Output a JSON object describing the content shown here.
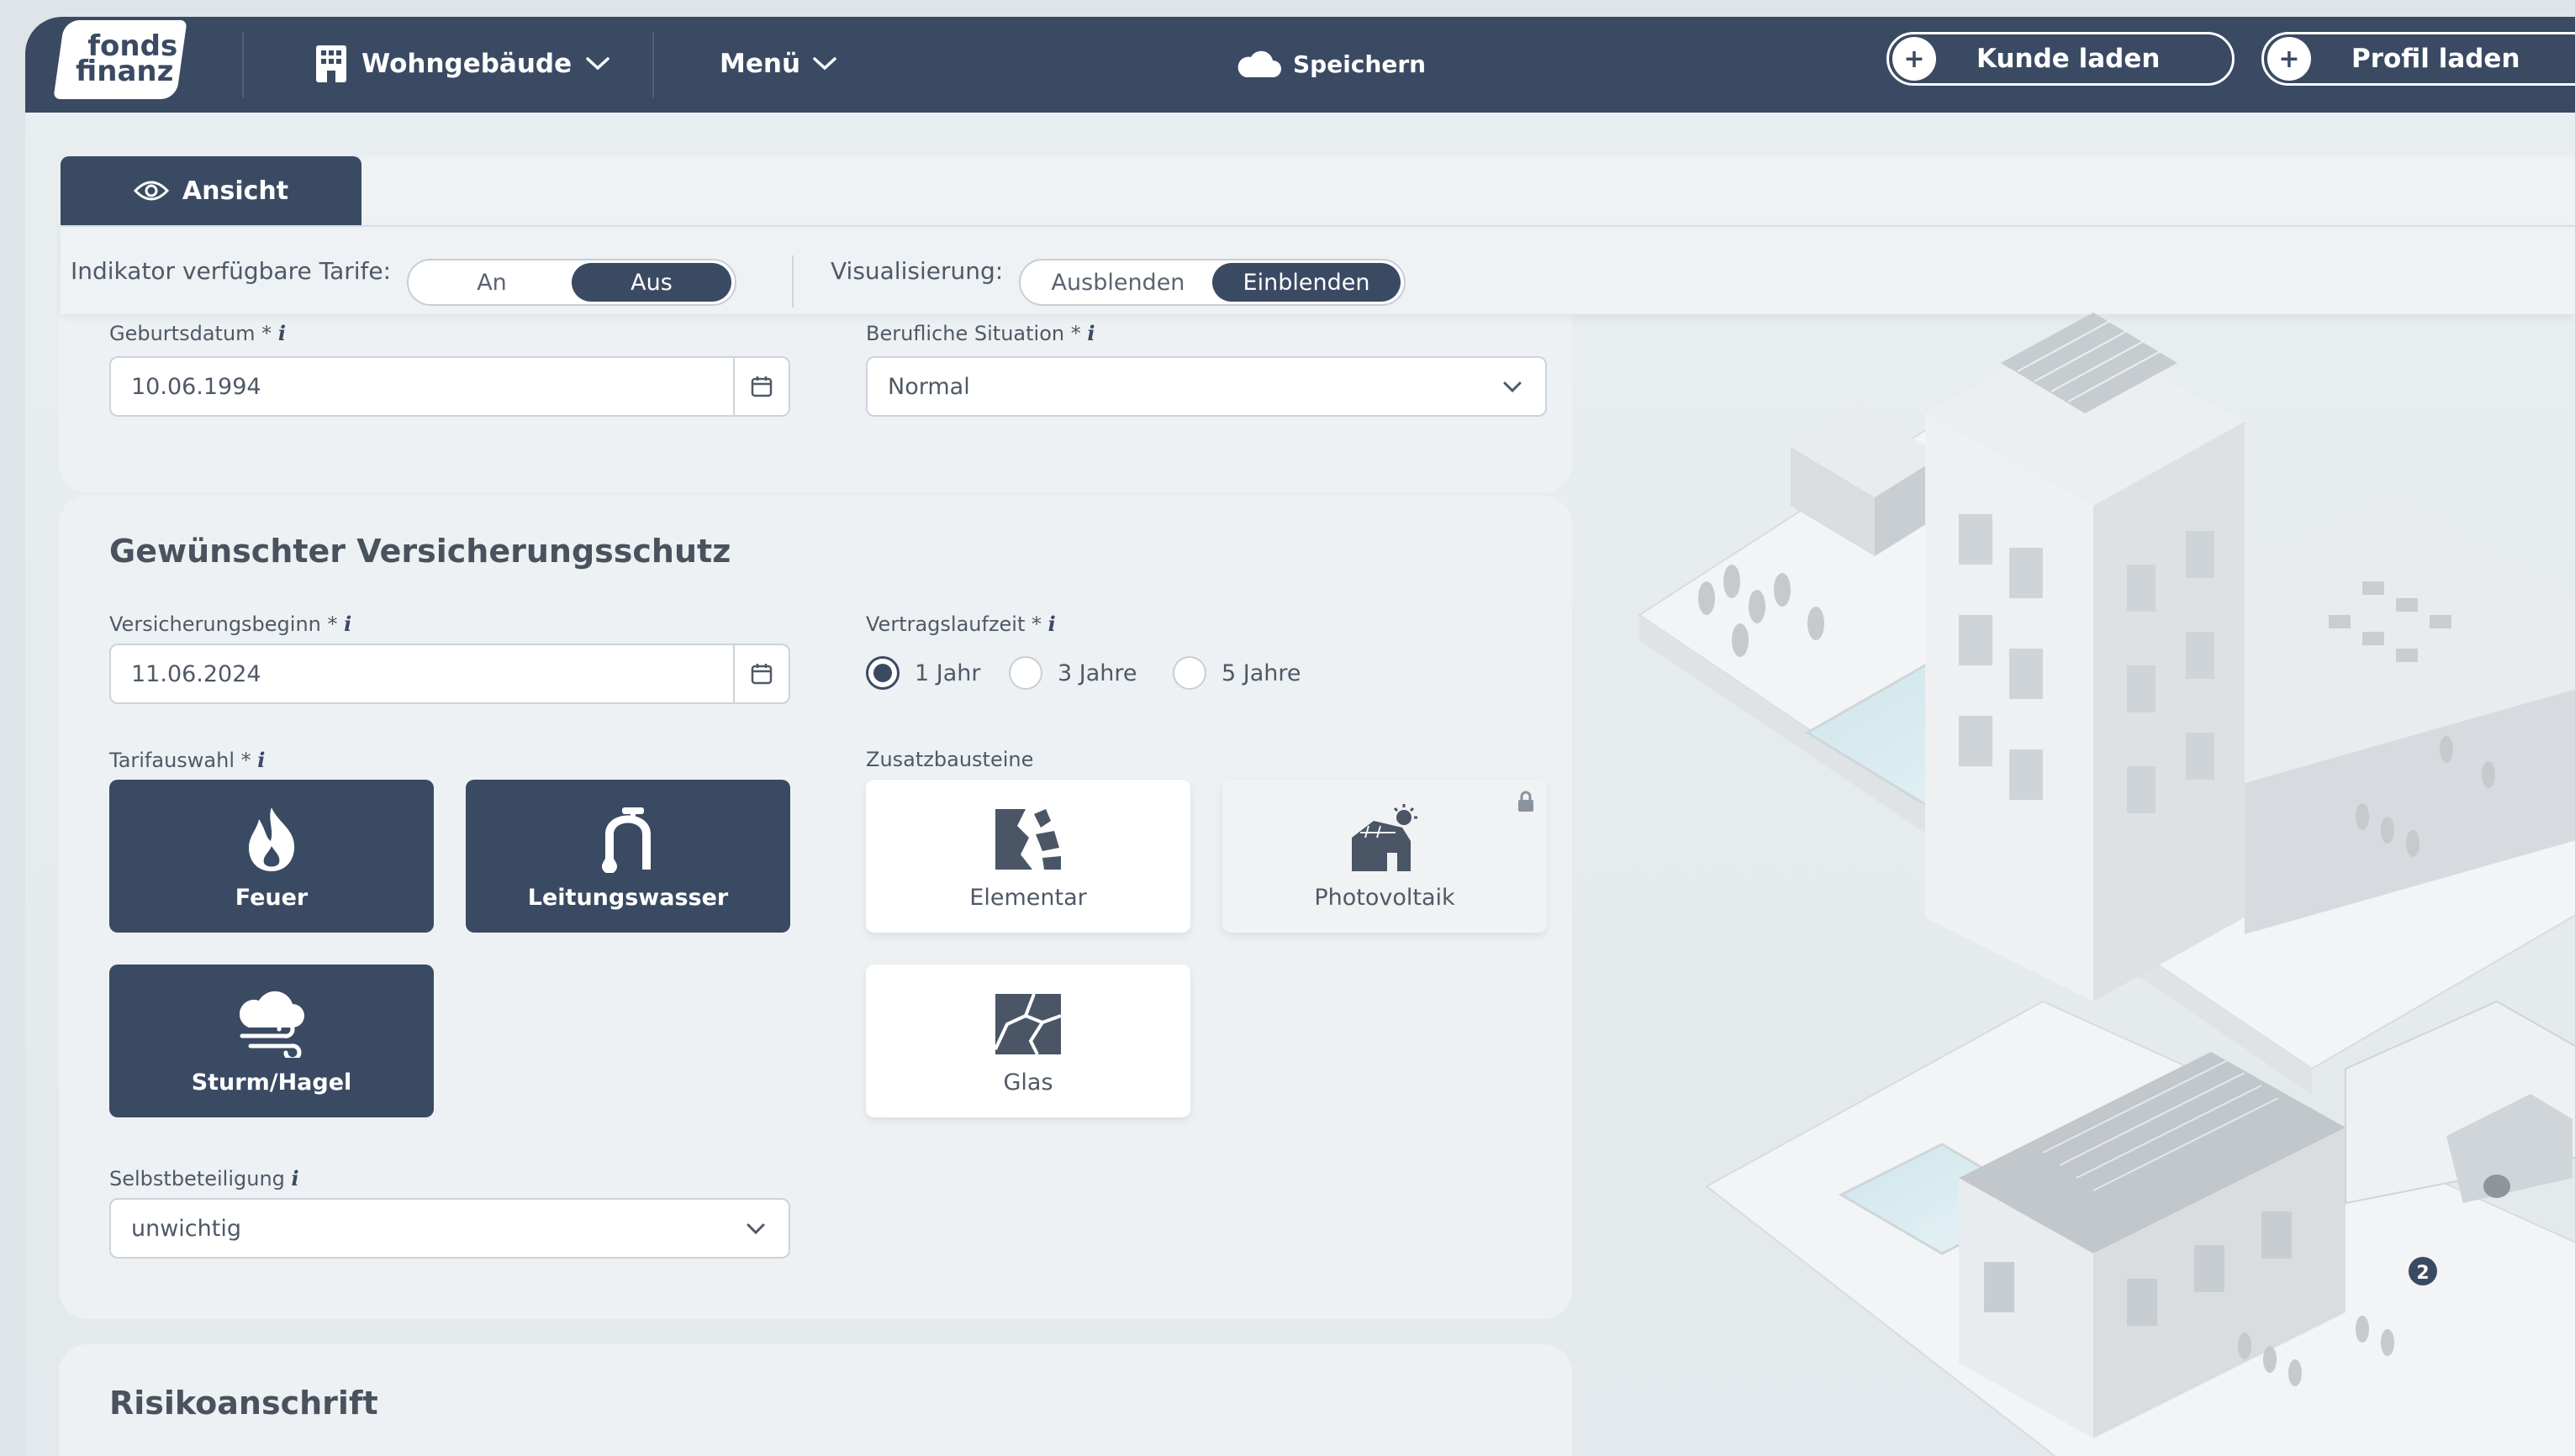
{
  "header": {
    "logo_line1": "fonds",
    "logo_line2": "finanz",
    "product_label": "Wohngebäude",
    "menu_label": "Menü",
    "save_label": "Speichern",
    "load_customer_label": "Kunde laden",
    "load_profile_label": "Profil laden",
    "plus_symbol": "+"
  },
  "view_panel": {
    "tab_label": "Ansicht",
    "tariff_indicator_label": "Indikator verfügbare Tarife:",
    "tariff_indicator_options": [
      "An",
      "Aus"
    ],
    "tariff_indicator_selected": "Aus",
    "visualization_label": "Visualisierung:",
    "visualization_options": [
      "Ausblenden",
      "Einblenden"
    ],
    "visualization_selected": "Einblenden"
  },
  "personal": {
    "birthdate_label": "Geburtsdatum *",
    "birthdate_value": "10.06.1994",
    "job_label": "Berufliche Situation *",
    "job_value": "Normal",
    "info_symbol": "i"
  },
  "coverage": {
    "title": "Gewünschter Versicherungsschutz",
    "start_label": "Versicherungsbeginn *",
    "start_value": "11.06.2024",
    "term_label": "Vertragslaufzeit *",
    "term_options": [
      "1 Jahr",
      "3 Jahre",
      "5 Jahre"
    ],
    "term_selected": "1 Jahr",
    "tariff_label": "Tarifauswahl *",
    "tariff_tiles": [
      "Feuer",
      "Leitungswasser",
      "Sturm/Hagel"
    ],
    "addons_label": "Zusatzbausteine",
    "addon_tiles": [
      "Elementar",
      "Photovoltaik",
      "Glas"
    ],
    "deductible_label": "Selbstbeteiligung",
    "deductible_value": "unwichtig"
  },
  "risk": {
    "title": "Risikoanschrift"
  },
  "illustration": {
    "badge_number": "2"
  },
  "colors": {
    "primary": "#3b4a63",
    "background": "#e7ecee",
    "card": "#edf1f3"
  }
}
